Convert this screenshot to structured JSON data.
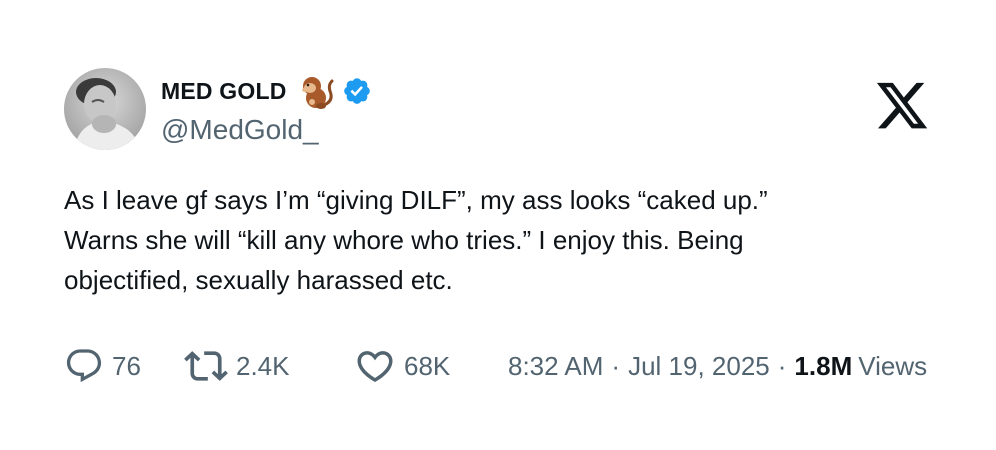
{
  "author": {
    "display_name": "MED GOLD",
    "handle": "@MedGold_",
    "name_emoji": "monkey-icon",
    "verified_badge": "verified-badge-icon",
    "avatar": "profile-photo"
  },
  "platform_logo": "x-logo-icon",
  "tweet": {
    "lines": [
      "As I leave gf says I’m “giving DILF”, my ass looks “caked up.”",
      "Warns she will “kill any whore who tries.” I enjoy this. Being",
      "objectified, sexually harassed etc."
    ]
  },
  "metrics": {
    "replies": "76",
    "retweets": "2.4K",
    "likes": "68K"
  },
  "meta": {
    "time": "8:32 AM",
    "separator": "·",
    "date": "Jul 19, 2025",
    "views_count": "1.8M",
    "views_label": "Views"
  },
  "colors": {
    "text_primary": "#0f1419",
    "text_secondary": "#536471",
    "verified_blue": "#1d9bf0"
  }
}
